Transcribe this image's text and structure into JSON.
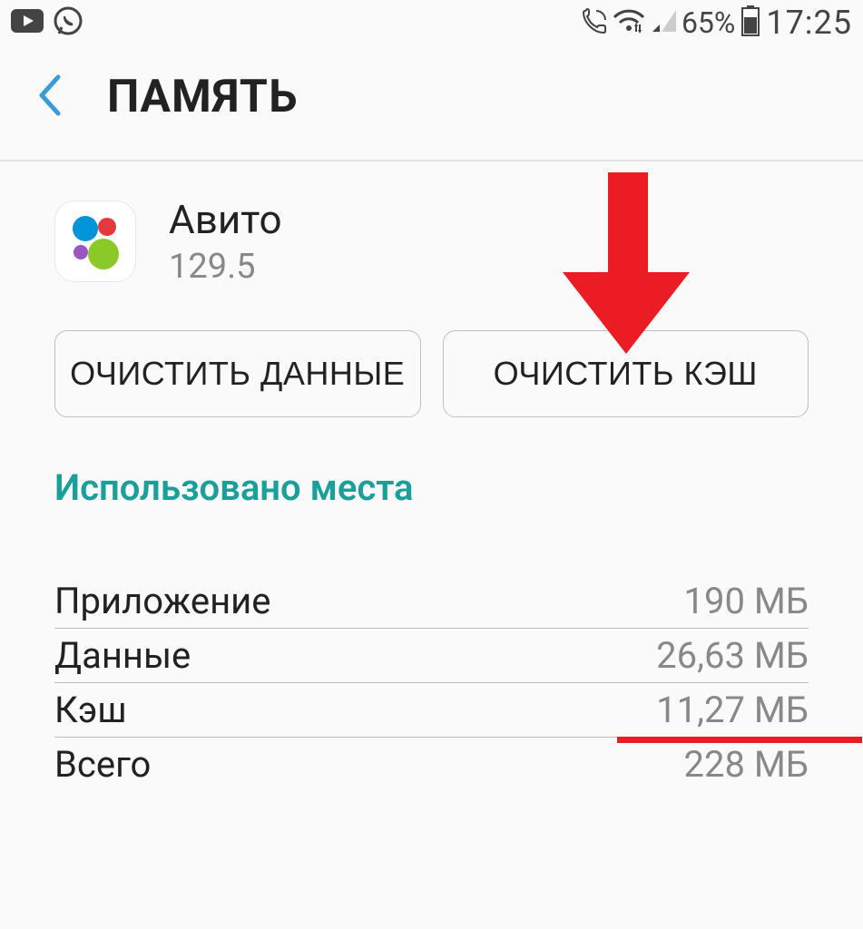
{
  "status_bar": {
    "battery_pct": "65%",
    "time": "17:25"
  },
  "header": {
    "title": "ПАМЯТЬ"
  },
  "app": {
    "name": "Авито",
    "version": "129.5"
  },
  "buttons": {
    "clear_data": "ОЧИСТИТЬ ДАННЫЕ",
    "clear_cache": "ОЧИСТИТЬ КЭШ"
  },
  "section": {
    "title": "Использовано места"
  },
  "storage": {
    "app_label": "Приложение",
    "app_value": "190 МБ",
    "data_label": "Данные",
    "data_value": "26,63 МБ",
    "cache_label": "Кэш",
    "cache_value": "11,27 МБ",
    "total_label": "Всего",
    "total_value": "228 МБ"
  },
  "annotation": {
    "arrow_color": "#ec1c24",
    "underline_color": "#ec1c24"
  }
}
